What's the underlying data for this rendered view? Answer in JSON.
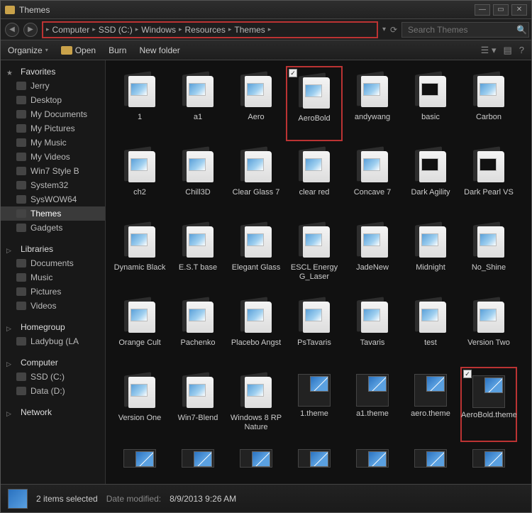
{
  "window": {
    "title": "Themes"
  },
  "breadcrumbs": [
    "Computer",
    "SSD (C:)",
    "Windows",
    "Resources",
    "Themes"
  ],
  "search": {
    "placeholder": "Search Themes"
  },
  "toolbar": {
    "organize": "Organize",
    "open": "Open",
    "burn": "Burn",
    "new_folder": "New folder"
  },
  "sidebar": {
    "favorites": {
      "label": "Favorites",
      "items": [
        "Jerry",
        "Desktop",
        "My Documents",
        "My Pictures",
        "My Music",
        "My Videos",
        "Win7 Style B",
        "System32",
        "SysWOW64",
        "Themes",
        "Gadgets"
      ]
    },
    "libraries": {
      "label": "Libraries",
      "items": [
        "Documents",
        "Music",
        "Pictures",
        "Videos"
      ]
    },
    "homegroup": {
      "label": "Homegroup",
      "items": [
        "Ladybug (LA"
      ]
    },
    "computer": {
      "label": "Computer",
      "items": [
        "SSD (C:)",
        "Data (D:)"
      ]
    },
    "network": {
      "label": "Network"
    }
  },
  "items": [
    {
      "label": "1",
      "kind": "folder"
    },
    {
      "label": "a1",
      "kind": "folder"
    },
    {
      "label": "Aero",
      "kind": "folder"
    },
    {
      "label": "AeroBold",
      "kind": "folder",
      "selected": true,
      "boxed": true
    },
    {
      "label": "andywang",
      "kind": "folder"
    },
    {
      "label": "basic",
      "kind": "folder-dark"
    },
    {
      "label": "Carbon",
      "kind": "folder"
    },
    {
      "label": "ch2",
      "kind": "folder"
    },
    {
      "label": "Chill3D",
      "kind": "folder"
    },
    {
      "label": "Clear Glass 7",
      "kind": "folder"
    },
    {
      "label": "clear red",
      "kind": "folder"
    },
    {
      "label": "Concave 7",
      "kind": "folder"
    },
    {
      "label": "Dark Agility",
      "kind": "folder-dark"
    },
    {
      "label": "Dark Pearl VS",
      "kind": "folder-dark"
    },
    {
      "label": "Dynamic Black",
      "kind": "folder"
    },
    {
      "label": "E.S.T  base",
      "kind": "folder"
    },
    {
      "label": "Elegant Glass",
      "kind": "folder"
    },
    {
      "label": "ESCL Energy G_Laser",
      "kind": "folder"
    },
    {
      "label": "JadeNew",
      "kind": "folder"
    },
    {
      "label": "Midnight",
      "kind": "folder"
    },
    {
      "label": "No_Shine",
      "kind": "folder"
    },
    {
      "label": "Orange Cult",
      "kind": "folder"
    },
    {
      "label": "Pachenko",
      "kind": "folder"
    },
    {
      "label": "Placebo Angst",
      "kind": "folder"
    },
    {
      "label": "PsTavaris",
      "kind": "folder"
    },
    {
      "label": "Tavaris",
      "kind": "folder"
    },
    {
      "label": "test",
      "kind": "folder"
    },
    {
      "label": "Version Two",
      "kind": "folder"
    },
    {
      "label": "Version One",
      "kind": "folder"
    },
    {
      "label": "Win7-Blend",
      "kind": "folder"
    },
    {
      "label": "Windows 8 RP Nature",
      "kind": "folder"
    },
    {
      "label": "1.theme",
      "kind": "file"
    },
    {
      "label": "a1.theme",
      "kind": "file"
    },
    {
      "label": "aero.theme",
      "kind": "file"
    },
    {
      "label": "AeroBold.theme",
      "kind": "file",
      "selected": true,
      "boxed": true
    },
    {
      "label": "",
      "kind": "file-partial"
    },
    {
      "label": "",
      "kind": "file-partial"
    },
    {
      "label": "",
      "kind": "file-partial"
    },
    {
      "label": "",
      "kind": "file-partial"
    },
    {
      "label": "",
      "kind": "file-partial"
    },
    {
      "label": "",
      "kind": "file-partial"
    },
    {
      "label": "",
      "kind": "file-partial"
    }
  ],
  "status": {
    "count": "2 items selected",
    "modified_label": "Date modified:",
    "modified_value": "8/9/2013 9:26 AM"
  }
}
